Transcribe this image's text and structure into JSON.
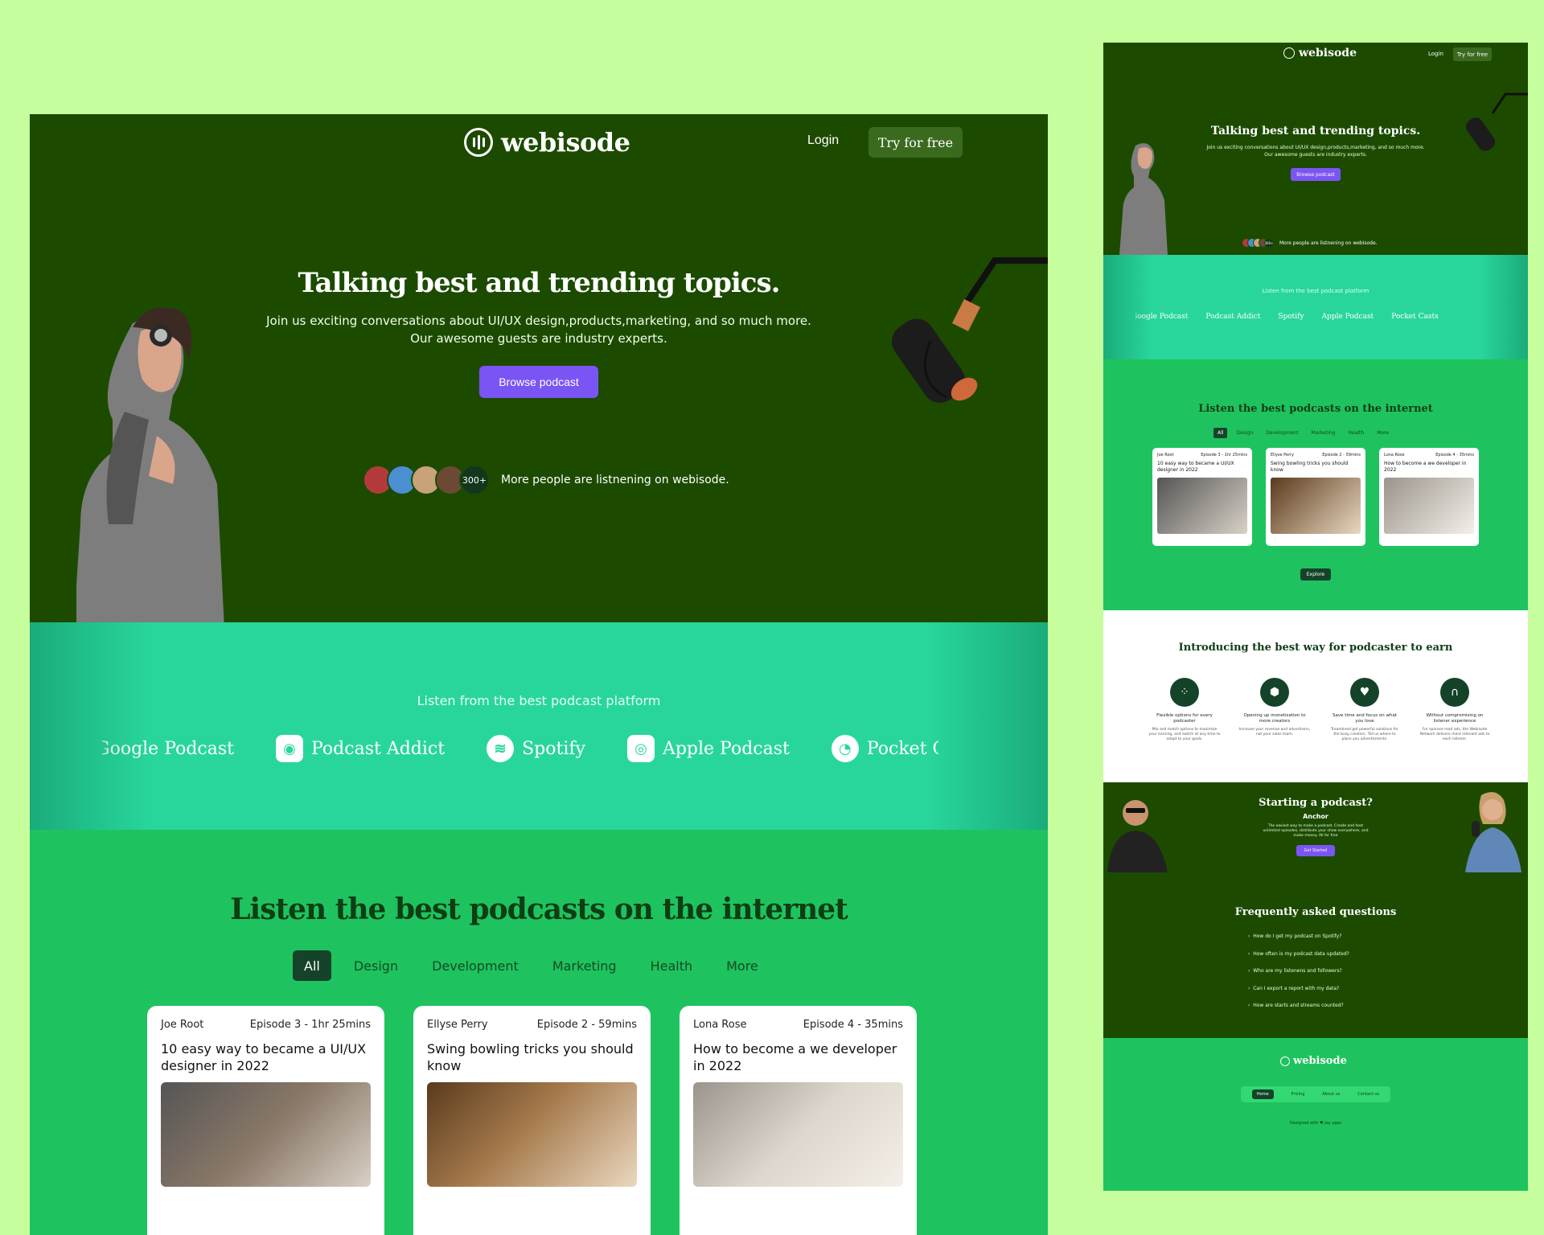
{
  "brand": {
    "name": "webisode"
  },
  "header": {
    "login": "Login",
    "try": "Try for free"
  },
  "hero": {
    "title": "Talking best and trending topics.",
    "subtitle_line1": "Join us exciting conversations about UI/UX design,products,marketing, and so much more.",
    "subtitle_line2": "Our awesome guests are industry experts.",
    "cta": "Browse podcast",
    "listener_count": "300+",
    "listener_text": "More people are listnening on webisode."
  },
  "platforms": {
    "title": "Listen from the best podcast platform",
    "items": [
      {
        "name": "Google Podcast",
        "icon": "google-podcast-icon"
      },
      {
        "name": "Podcast Addict",
        "icon": "podcast-addict-icon"
      },
      {
        "name": "Spotify",
        "icon": "spotify-icon"
      },
      {
        "name": "Apple Podcast",
        "icon": "apple-podcast-icon"
      },
      {
        "name": "Pocket Casts",
        "icon": "pocket-casts-icon"
      }
    ]
  },
  "listen": {
    "title": "Listen the best podcasts on the internet",
    "tabs": [
      "All",
      "Design",
      "Development",
      "Marketing",
      "Health",
      "More"
    ],
    "cards": [
      {
        "author": "Joe Root",
        "episode": "Episode 3 - 1hr 25mins",
        "title": "10 easy way to became a UI/UX designer in 2022"
      },
      {
        "author": "Ellyse Perry",
        "episode": "Episode 2 - 59mins",
        "title": "Swing bowling tricks you should know"
      },
      {
        "author": "Lona Rose",
        "episode": "Episode 4 - 35mins",
        "title": "How to become a we developer in 2022"
      }
    ],
    "explore": "Explore"
  },
  "earn": {
    "title": "Introducing the best way for podcaster to earn",
    "features": [
      {
        "title": "Flexible options for every podcaster",
        "desc": "Mix and match options to maximize your earning, and switch at any time to adapt to your goals."
      },
      {
        "title": "Opening up monetization to more creators",
        "desc": "Increase your revenue and advertisers, not your sales team."
      },
      {
        "title": "Save time and focus on what you love",
        "desc": "Treamlined get powerful solutions for the busy creators. Tell us where to place you advertisments."
      },
      {
        "title": "Without compromising on listener experience",
        "desc": "For sponsor-read ads, the Webisode Network delivers more relevant ads to each listener."
      }
    ]
  },
  "anchor": {
    "title": "Starting a podcast?",
    "subtitle": "Anchor",
    "desc": "The easiest way to make a podcast. Create and host unlimited episodes, distribute your show everywhere, and make money. All for free",
    "cta": "Get Started"
  },
  "faq": {
    "title": "Frequently asked questions",
    "items": [
      "How do I get my podcast on Spotify?",
      "How often is my podcast data updated?",
      "Who are my listenens and followers?",
      "Can I export a report with my data?",
      "How are starts and streams counted?"
    ]
  },
  "footer": {
    "nav": [
      "Home",
      "Pricing",
      "About us",
      "Contact us"
    ],
    "designed": "Designed with ♥ Jay ugas"
  },
  "colors": {
    "dark_green": "#1c4b00",
    "teal": "#28d69c",
    "green": "#1ec35f",
    "purple": "#7b55f3",
    "background": "#c6fe9e"
  }
}
